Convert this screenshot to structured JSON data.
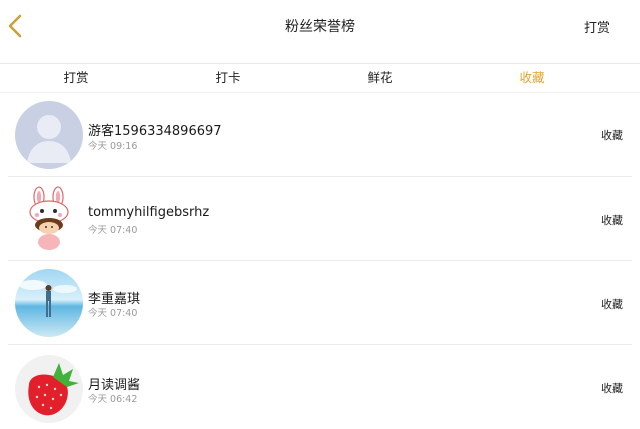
{
  "nav": {
    "title": "粉丝荣誉榜",
    "right_label": "打赏"
  },
  "tabs": [
    {
      "label": "打赏",
      "active": false
    },
    {
      "label": "打卡",
      "active": false
    },
    {
      "label": "鲜花",
      "active": false
    },
    {
      "label": "收藏",
      "active": true
    }
  ],
  "accent_color": "#e0a52e",
  "rows": [
    {
      "name": "游客1596334896697",
      "time": "今天 09:16",
      "action": "收藏",
      "avatar_icon": "default-user-avatar-icon"
    },
    {
      "name": "tommyhilfigebsrhz",
      "time": "今天 07:40",
      "action": "收藏",
      "avatar_icon": "bunny-hat-cartoon-avatar-icon"
    },
    {
      "name": "李重嘉琪",
      "time": "今天 07:40",
      "action": "收藏",
      "avatar_icon": "beach-photo-avatar-icon"
    },
    {
      "name": "月读调酱",
      "time": "今天 06:42",
      "action": "收藏",
      "avatar_icon": "strawberry-avatar-icon"
    }
  ]
}
